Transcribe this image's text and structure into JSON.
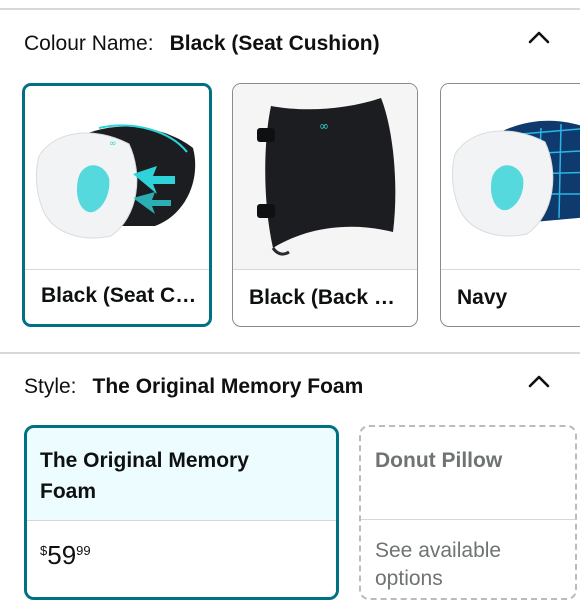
{
  "colour": {
    "label": "Colour Name:",
    "selected": "Black (Seat Cushion)",
    "options": [
      {
        "name": "Black (Seat Cushion)",
        "image": "seat-cushion-black"
      },
      {
        "name": "Black (Back Cushion)",
        "image": "back-cushion-black"
      },
      {
        "name": "Navy",
        "image": "seat-cushion-navy"
      }
    ]
  },
  "style": {
    "label": "Style:",
    "selected": "The Original Memory Foam",
    "options": [
      {
        "title_line1": "The Original Memory",
        "title_line2": "Foam",
        "price_currency": "$",
        "price_whole": "59",
        "price_fraction": "99"
      },
      {
        "title_line1": "Donut Pillow",
        "note_line1": "See available",
        "note_line2": "options"
      }
    ]
  },
  "icons": {
    "collapse": "chevron-up-icon"
  },
  "colors": {
    "accent": "#007185",
    "selected_bg": "#edfdff",
    "border": "#888c8c"
  }
}
